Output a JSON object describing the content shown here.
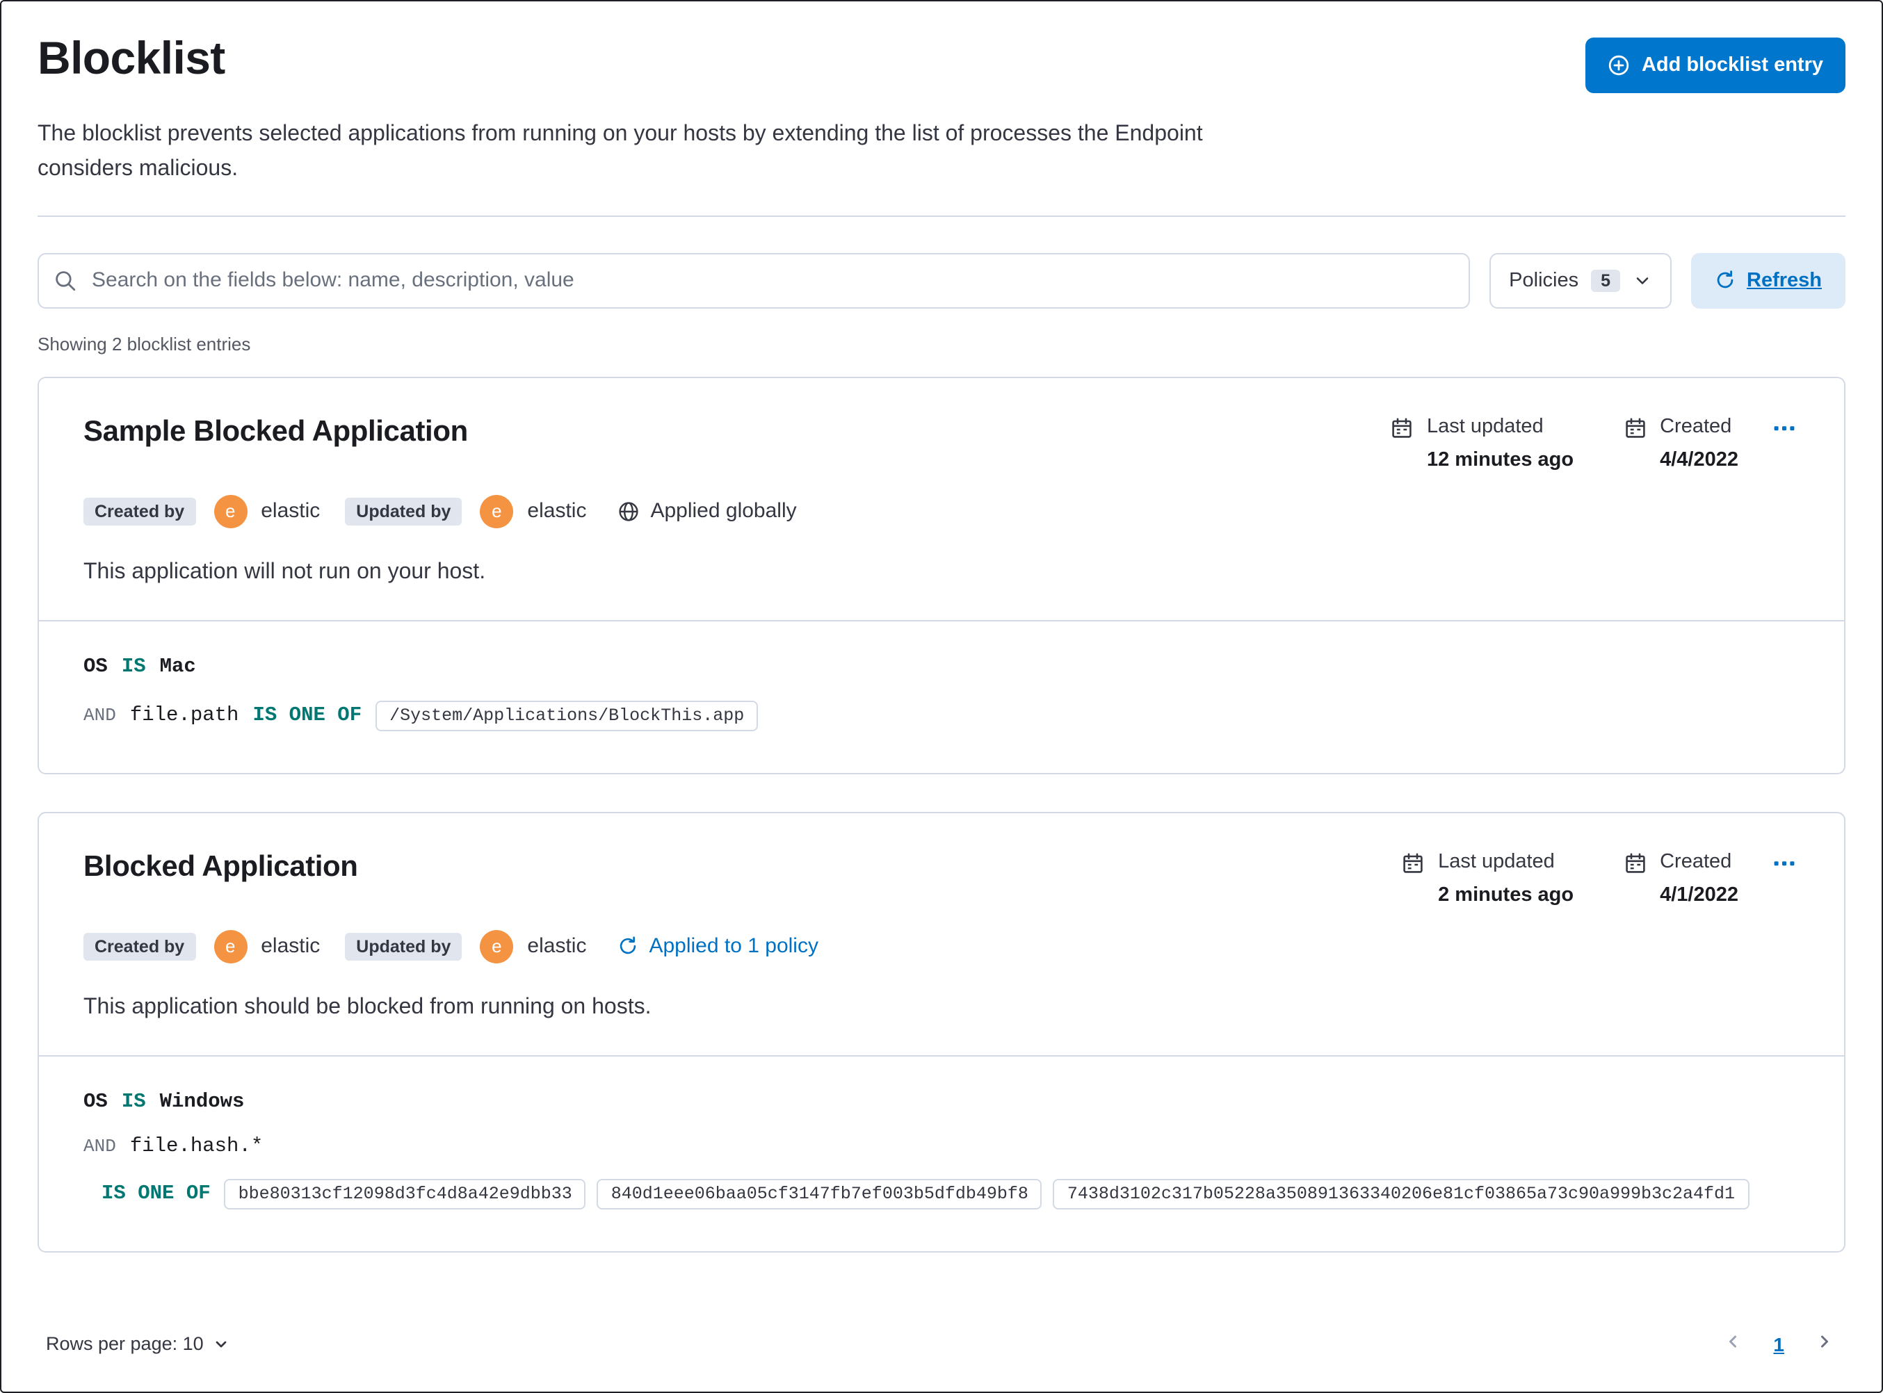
{
  "colors": {
    "primary_button": "#0077cc",
    "link": "#0071c2",
    "operator_teal": "#007871",
    "avatar_orange": "#f49342",
    "border": "#d3dae6",
    "badge_bg": "#e0e5ee",
    "refresh_bg": "#dcebf7"
  },
  "header": {
    "title": "Blocklist",
    "description": "The blocklist prevents selected applications from running on your hosts by extending the list of processes the Endpoint considers malicious.",
    "add_button_label": "Add blocklist entry"
  },
  "toolbar": {
    "search_placeholder": "Search on the fields below: name, description, value",
    "policies_label": "Policies",
    "policies_count": "5",
    "refresh_label": "Refresh"
  },
  "list": {
    "showing_text": "Showing 2 blocklist entries"
  },
  "entries": [
    {
      "title": "Sample Blocked Application",
      "created_by_label": "Created by",
      "created_by_avatar": "e",
      "created_by_user": "elastic",
      "updated_by_label": "Updated by",
      "updated_by_avatar": "e",
      "updated_by_user": "elastic",
      "scope_label": "Applied globally",
      "last_updated_label": "Last updated",
      "last_updated_value": "12 minutes ago",
      "created_label": "Created",
      "created_value": "4/4/2022",
      "description": "This application will not run on your host.",
      "criteria": {
        "os_field": "OS",
        "os_operator": "IS",
        "os_value": "Mac",
        "conjunction": "AND",
        "field": "file.path",
        "operator": "IS ONE OF",
        "values": [
          "/System/Applications/BlockThis.app"
        ]
      }
    },
    {
      "title": "Blocked Application",
      "created_by_label": "Created by",
      "created_by_avatar": "e",
      "created_by_user": "elastic",
      "updated_by_label": "Updated by",
      "updated_by_avatar": "e",
      "updated_by_user": "elastic",
      "scope_label": "Applied to 1 policy",
      "last_updated_label": "Last updated",
      "last_updated_value": "2 minutes ago",
      "created_label": "Created",
      "created_value": "4/1/2022",
      "description": "This application should be blocked from running on hosts.",
      "criteria": {
        "os_field": "OS",
        "os_operator": "IS",
        "os_value": "Windows",
        "conjunction": "AND",
        "field": "file.hash.*",
        "operator": "IS ONE OF",
        "values": [
          "bbe80313cf12098d3fc4d8a42e9dbb33",
          "840d1eee06baa05cf3147fb7ef003b5dfdb49bf8",
          "7438d3102c317b05228a350891363340206e81cf03865a73c90a999b3c2a4fd1"
        ]
      }
    }
  ],
  "footer": {
    "rows_per_page_label": "Rows per page: 10",
    "current_page": "1"
  }
}
